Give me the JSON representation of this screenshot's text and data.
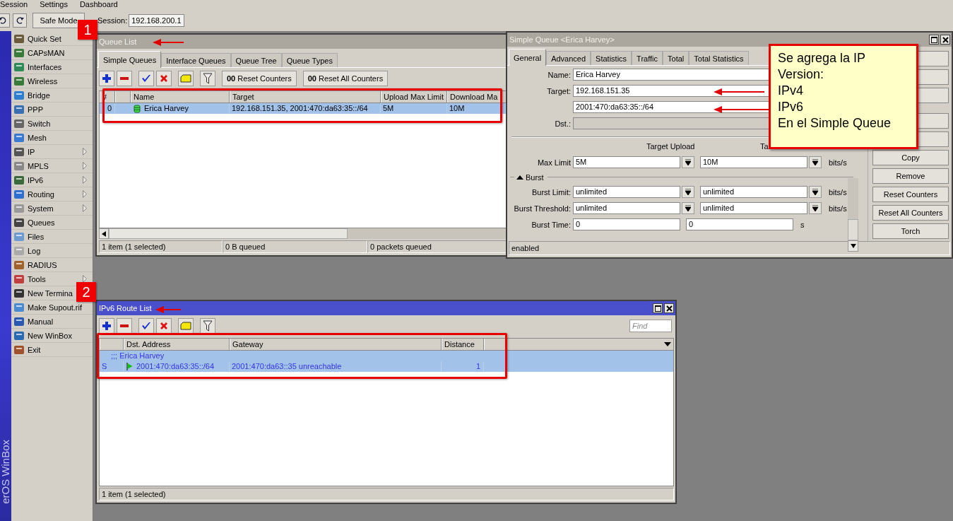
{
  "menubar": [
    "Session",
    "Settings",
    "Dashboard"
  ],
  "toolbar": {
    "safe_mode": "Safe Mode",
    "session_label": "Session:",
    "session_value": "192.168.200.1"
  },
  "brand": "erOS WinBox",
  "sidebar": [
    {
      "label": "Quick Set",
      "submenu": false
    },
    {
      "label": "CAPsMAN",
      "submenu": false
    },
    {
      "label": "Interfaces",
      "submenu": false
    },
    {
      "label": "Wireless",
      "submenu": false
    },
    {
      "label": "Bridge",
      "submenu": false
    },
    {
      "label": "PPP",
      "submenu": false
    },
    {
      "label": "Switch",
      "submenu": false
    },
    {
      "label": "Mesh",
      "submenu": false
    },
    {
      "label": "IP",
      "submenu": true
    },
    {
      "label": "MPLS",
      "submenu": true
    },
    {
      "label": "IPv6",
      "submenu": true
    },
    {
      "label": "Routing",
      "submenu": true
    },
    {
      "label": "System",
      "submenu": true
    },
    {
      "label": "Queues",
      "submenu": false
    },
    {
      "label": "Files",
      "submenu": false
    },
    {
      "label": "Log",
      "submenu": false
    },
    {
      "label": "RADIUS",
      "submenu": false
    },
    {
      "label": "Tools",
      "submenu": true
    },
    {
      "label": "New Termina",
      "submenu": false
    },
    {
      "label": "Make Supout.rif",
      "submenu": false
    },
    {
      "label": "Manual",
      "submenu": false
    },
    {
      "label": "New WinBox",
      "submenu": false
    },
    {
      "label": "Exit",
      "submenu": false
    }
  ],
  "queue_list": {
    "title": "Queue List",
    "active": false,
    "tabs": [
      {
        "label": "Simple Queues",
        "selected": true
      },
      {
        "label": "Interface Queues",
        "selected": false
      },
      {
        "label": "Queue Tree",
        "selected": false
      },
      {
        "label": "Queue Types",
        "selected": false
      }
    ],
    "counter_buttons": [
      "**00** Reset Counters",
      "**00** Reset All Counters"
    ],
    "columns": [
      "#",
      "Name",
      "Target",
      "Upload Max Limit",
      "Download Ma"
    ],
    "rows": [
      {
        "number": "0",
        "name": "Erica Harvey",
        "target": "192.168.151.35, 2001:470:da63:35::/64",
        "upload": "5M",
        "download": "10M",
        "selected": true
      }
    ],
    "status": [
      "1 item (1 selected)",
      "0 B queued",
      "0 packets queued"
    ]
  },
  "simple_queue": {
    "title": "Simple Queue <Erica Harvey>",
    "active": false,
    "tabs": [
      {
        "label": "General",
        "selected": true
      },
      {
        "label": "Advanced",
        "selected": false
      },
      {
        "label": "Statistics",
        "selected": false
      },
      {
        "label": "Traffic",
        "selected": false
      },
      {
        "label": "Total",
        "selected": false
      },
      {
        "label": "Total Statistics",
        "selected": false
      }
    ],
    "name_label": "Name:",
    "name_value": "Erica Harvey",
    "target_label": "Target:",
    "targets": [
      "192.168.151.35",
      "2001:470:da63:35::/64"
    ],
    "dst_label": "Dst.:",
    "headings": [
      "Target Upload",
      "Ta"
    ],
    "limits": [
      {
        "label": "Max Limit",
        "upload": "5M",
        "download": "10M",
        "unit": "bits/s",
        "dropdown": true
      }
    ],
    "burst_label": "Burst",
    "burst_expanded": true,
    "burst": [
      {
        "label": "Burst Limit:",
        "upload": "unlimited",
        "download": "unlimited",
        "unit": "bits/s",
        "dropdown": true
      },
      {
        "label": "Burst Threshold:",
        "upload": "unlimited",
        "download": "unlimited",
        "unit": "bits/s",
        "dropdown": true
      },
      {
        "label": "Burst Time:",
        "upload": "0",
        "download": "0",
        "unit": "s",
        "dropdown": false
      }
    ],
    "buttons": [
      "Copy",
      "Remove",
      "Reset Counters",
      "Reset All Counters",
      "Torch"
    ],
    "status": "enabled"
  },
  "ipv6_routes": {
    "title": "IPv6 Route List",
    "active": true,
    "find_placeholder": "Find",
    "columns": [
      "Dst. Address",
      "Gateway",
      "Distance"
    ],
    "comment": ";;; Erica Harvey",
    "rows": [
      {
        "flag": "S",
        "dst": "2001:470:da63:35::/64",
        "gateway": "2001:470:da63::35 unreachable",
        "distance": "1",
        "selected": true
      }
    ],
    "status": "1 item (1 selected)"
  },
  "annotations": {
    "badges": [
      "1",
      "2"
    ],
    "note": [
      "Se agrega la IP",
      "Version:",
      "IPv4",
      "IPv6",
      "En el Simple Queue"
    ]
  }
}
